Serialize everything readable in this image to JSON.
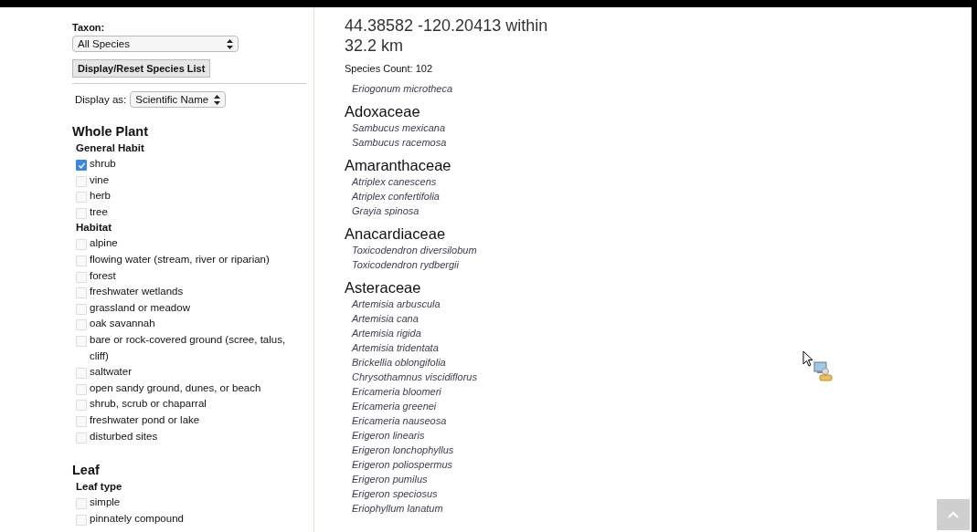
{
  "sidebar": {
    "taxon_label": "Taxon:",
    "taxon_select": {
      "value": "All Species"
    },
    "reset_button": "Display/Reset Species List",
    "display_label": "Display as:",
    "display_select": {
      "value": "Scientific Name"
    },
    "sections": [
      {
        "title": "Whole Plant",
        "groups": [
          {
            "title": "General Habit",
            "items": [
              {
                "label": "shrub",
                "checked": true
              },
              {
                "label": "vine",
                "checked": false
              },
              {
                "label": "herb",
                "checked": false
              },
              {
                "label": "tree",
                "checked": false
              }
            ]
          },
          {
            "title": "Habitat",
            "items": [
              {
                "label": "alpine",
                "checked": false
              },
              {
                "label": "flowing water (stream, river or riparian)",
                "checked": false
              },
              {
                "label": "forest",
                "checked": false
              },
              {
                "label": "freshwater wetlands",
                "checked": false
              },
              {
                "label": "grassland or meadow",
                "checked": false
              },
              {
                "label": "oak savannah",
                "checked": false
              },
              {
                "label": "bare or rock-covered ground (scree, talus, cliff)",
                "checked": false
              },
              {
                "label": "saltwater",
                "checked": false
              },
              {
                "label": "open sandy ground, dunes, or beach",
                "checked": false
              },
              {
                "label": "shrub, scrub or chaparral",
                "checked": false
              },
              {
                "label": "freshwater pond or lake",
                "checked": false
              },
              {
                "label": "disturbed sites",
                "checked": false
              }
            ]
          }
        ]
      },
      {
        "title": "Leaf",
        "groups": [
          {
            "title": "Leaf type",
            "items": [
              {
                "label": "simple",
                "checked": false
              },
              {
                "label": "pinnately compound",
                "checked": false
              }
            ]
          }
        ]
      }
    ]
  },
  "main": {
    "title": "44.38582 -120.20413 within 32.2 km",
    "species_count": "Species Count: 102",
    "entries": [
      {
        "kind": "species",
        "name": "Eriogonum microtheca"
      },
      {
        "kind": "family",
        "name": "Adoxaceae"
      },
      {
        "kind": "species",
        "name": "Sambucus mexicana"
      },
      {
        "kind": "species",
        "name": "Sambucus racemosa"
      },
      {
        "kind": "family",
        "name": "Amaranthaceae"
      },
      {
        "kind": "species",
        "name": "Atriplex canescens"
      },
      {
        "kind": "species",
        "name": "Atriplex confertifolia"
      },
      {
        "kind": "species",
        "name": "Grayia spinosa"
      },
      {
        "kind": "family",
        "name": "Anacardiaceae"
      },
      {
        "kind": "species",
        "name": "Toxicodendron diversilobum"
      },
      {
        "kind": "species",
        "name": "Toxicodendron rydbergii"
      },
      {
        "kind": "family",
        "name": "Asteraceae"
      },
      {
        "kind": "species",
        "name": "Artemisia arbuscula"
      },
      {
        "kind": "species",
        "name": "Artemisia cana"
      },
      {
        "kind": "species",
        "name": "Artemisia rigida"
      },
      {
        "kind": "species",
        "name": "Artemisia tridentata"
      },
      {
        "kind": "species",
        "name": "Brickellia oblongifolia"
      },
      {
        "kind": "species",
        "name": "Chrysothamnus viscidiflorus"
      },
      {
        "kind": "species",
        "name": "Ericameria bloomeri"
      },
      {
        "kind": "species",
        "name": "Ericameria greenei"
      },
      {
        "kind": "species",
        "name": "Ericameria nauseosa"
      },
      {
        "kind": "species",
        "name": "Erigeron linearis"
      },
      {
        "kind": "species",
        "name": "Erigeron lonchophyllus"
      },
      {
        "kind": "species",
        "name": "Erigeron poliospermus"
      },
      {
        "kind": "species",
        "name": "Erigeron pumilus"
      },
      {
        "kind": "species",
        "name": "Erigeron speciosus"
      },
      {
        "kind": "species",
        "name": "Eriophyllum lanatum"
      }
    ]
  }
}
